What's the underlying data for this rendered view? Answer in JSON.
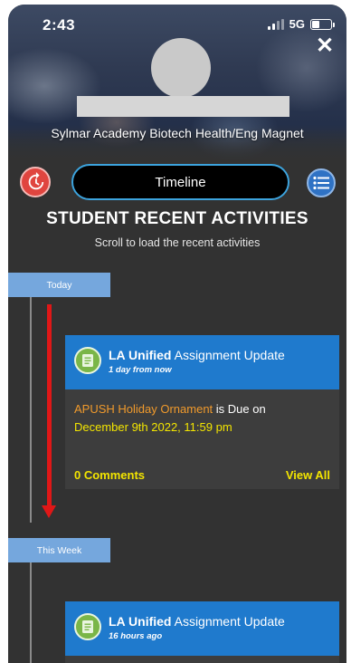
{
  "status_bar": {
    "time": "2:43",
    "network": "5G"
  },
  "profile": {
    "school": "Sylmar Academy Biotech Health/Eng Magnet"
  },
  "nav": {
    "timeline_label": "Timeline"
  },
  "section": {
    "title": "STUDENT RECENT ACTIVITIES",
    "subtitle": "Scroll to load the recent activities"
  },
  "timeline": {
    "groups": [
      {
        "label": "Today"
      },
      {
        "label": "This Week"
      }
    ],
    "cards": [
      {
        "org": "LA Unified",
        "title_suffix": "Assignment Update",
        "when": "1 day from now",
        "assignment": "APUSH Holiday Ornament",
        "due_text": " is Due on",
        "due_date": "December 9th 2022, 11:59 pm",
        "comments": "0 Comments",
        "view_all": "View All"
      },
      {
        "org": "LA Unified",
        "title_suffix": "Assignment Update",
        "when": "16 hours ago"
      }
    ]
  },
  "colors": {
    "background": "#323232",
    "card_header": "#1f7acd",
    "date_tab": "#75a7dd",
    "accent_yellow": "#f3e500",
    "accent_orange": "#f09a2c",
    "history_button": "#e0453f",
    "arrow": "#e01717"
  },
  "icons": [
    "history-icon",
    "list-menu-icon",
    "close-icon",
    "assignment-icon",
    "signal-icon",
    "battery-icon"
  ]
}
